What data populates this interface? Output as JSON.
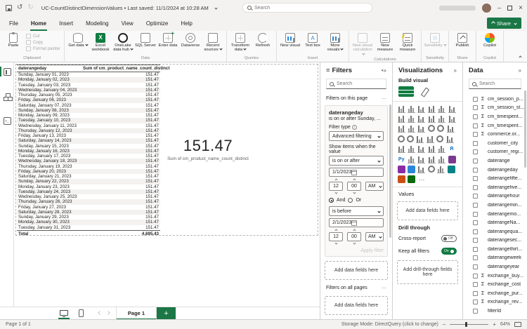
{
  "window": {
    "title": "UC-CountDistinctDimensionValues",
    "saved_info": "• Last saved: 11/1/2024 at 10:28 AM",
    "search_placeholder": "Search"
  },
  "menu": {
    "items": [
      "File",
      "Home",
      "Insert",
      "Modeling",
      "View",
      "Optimize",
      "Help"
    ],
    "active": "Home",
    "share_label": "Share"
  },
  "ribbon": {
    "groups": [
      {
        "name": "Clipboard",
        "buttons": [
          {
            "label": "Paste",
            "icon": "paste",
            "size": "large"
          },
          {
            "label": "Cut",
            "icon": "cut",
            "size": "small",
            "disabled": true
          },
          {
            "label": "Copy",
            "icon": "copy",
            "size": "small",
            "disabled": true
          },
          {
            "label": "Format painter",
            "icon": "format-painter",
            "size": "small",
            "disabled": true
          }
        ]
      },
      {
        "name": "Data",
        "buttons": [
          {
            "label": "Get data",
            "icon": "get-data",
            "dropdown": true
          },
          {
            "label": "Excel workbook",
            "icon": "excel"
          },
          {
            "label": "OneLake data hub",
            "icon": "onelake",
            "dropdown": true
          },
          {
            "label": "SQL Server",
            "icon": "sql-server"
          },
          {
            "label": "Enter data",
            "icon": "enter-data"
          },
          {
            "label": "Dataverse",
            "icon": "dataverse"
          },
          {
            "label": "Recent sources",
            "icon": "recent-sources",
            "dropdown": true
          }
        ]
      },
      {
        "name": "Queries",
        "buttons": [
          {
            "label": "Transform data",
            "icon": "transform-data",
            "dropdown": true
          },
          {
            "label": "Refresh",
            "icon": "refresh"
          }
        ]
      },
      {
        "name": "Insert",
        "buttons": [
          {
            "label": "New visual",
            "icon": "new-visual"
          },
          {
            "label": "Text box",
            "icon": "text-box"
          },
          {
            "label": "More visuals",
            "icon": "more-visuals",
            "dropdown": true
          }
        ]
      },
      {
        "name": "Calculations",
        "buttons": [
          {
            "label": "New visual calculation",
            "icon": "new-visual-calculation",
            "dropdown": true,
            "disabled": true
          },
          {
            "label": "New measure",
            "icon": "new-measure"
          },
          {
            "label": "Quick measure",
            "icon": "quick-measure"
          }
        ]
      },
      {
        "name": "Sensitivity",
        "buttons": [
          {
            "label": "Sensitivity",
            "icon": "sensitivity",
            "dropdown": true,
            "disabled": true
          }
        ]
      },
      {
        "name": "Share",
        "buttons": [
          {
            "label": "Publish",
            "icon": "publish"
          }
        ]
      },
      {
        "name": "Copilot",
        "buttons": [
          {
            "label": "Copilot",
            "icon": "copilot"
          }
        ]
      }
    ]
  },
  "table": {
    "col1": "daterangeday",
    "col2": "Sum of cm_product_name_count_distinct",
    "rows": [
      [
        "Sunday, January 01, 2023",
        "151.47"
      ],
      [
        "Monday, January 02, 2023",
        "151.47"
      ],
      [
        "Tuesday, January 03, 2023",
        "151.47"
      ],
      [
        "Wednesday, January 04, 2023",
        "151.47"
      ],
      [
        "Thursday, January 05, 2023",
        "151.47"
      ],
      [
        "Friday, January 06, 2023",
        "151.47"
      ],
      [
        "Saturday, January 07, 2023",
        "151.47"
      ],
      [
        "Sunday, January 08, 2023",
        "151.47"
      ],
      [
        "Monday, January 09, 2023",
        "151.47"
      ],
      [
        "Tuesday, January 10, 2023",
        "151.47"
      ],
      [
        "Wednesday, January 11, 2023",
        "151.47"
      ],
      [
        "Thursday, January 12, 2023",
        "151.47"
      ],
      [
        "Friday, January 13, 2023",
        "151.47"
      ],
      [
        "Saturday, January 14, 2023",
        "151.47"
      ],
      [
        "Sunday, January 15, 2023",
        "151.47"
      ],
      [
        "Monday, January 16, 2023",
        "151.47"
      ],
      [
        "Tuesday, January 17, 2023",
        "151.47"
      ],
      [
        "Wednesday, January 18, 2023",
        "151.47"
      ],
      [
        "Thursday, January 19, 2023",
        "151.47"
      ],
      [
        "Friday, January 20, 2023",
        "151.47"
      ],
      [
        "Saturday, January 21, 2023",
        "151.47"
      ],
      [
        "Sunday, January 22, 2023",
        "151.47"
      ],
      [
        "Monday, January 23, 2023",
        "151.47"
      ],
      [
        "Tuesday, January 24, 2023",
        "151.47"
      ],
      [
        "Wednesday, January 25, 2023",
        "151.47"
      ],
      [
        "Thursday, January 26, 2023",
        "151.47"
      ],
      [
        "Friday, January 27, 2023",
        "151.47"
      ],
      [
        "Saturday, January 28, 2023",
        "151.47"
      ],
      [
        "Sunday, January 29, 2023",
        "151.47"
      ],
      [
        "Monday, January 30, 2023",
        "151.47"
      ],
      [
        "Tuesday, January 31, 2023",
        "151.47"
      ]
    ],
    "total_label": "Total",
    "total_value": "4,695.43"
  },
  "card": {
    "value": "151.47",
    "label": "Sum of cm_product_name_count_distinct"
  },
  "filters": {
    "header": "Filters",
    "search_placeholder": "Search",
    "section_page": "Filters on this page",
    "card": {
      "field": "daterangeday",
      "summary": "is on or after Sunday, ...",
      "filter_type_label": "Filter type",
      "filter_type_value": "Advanced filtering",
      "show_items_label": "Show items when the value",
      "cond1": {
        "op": "is on or after",
        "date": "1/1/2023",
        "hour": "12",
        "minute": "00",
        "ampm": "AM"
      },
      "and_label": "And",
      "or_label": "Or",
      "cond2": {
        "op": "is before",
        "date": "2/1/2023",
        "hour": "12",
        "minute": "00",
        "ampm": "AM"
      },
      "apply_label": "Apply filter"
    },
    "add_fields": "Add data fields here",
    "section_all": "Filters on all pages",
    "add_fields2": "Add data fields here"
  },
  "viz": {
    "header": "Visualizations",
    "build_label": "Build visual",
    "values_label": "Values",
    "add_fields": "Add data fields here",
    "drill": {
      "title": "Drill through",
      "cross_report": "Cross-report",
      "cross_state": "Off",
      "keep_filters": "Keep all filters",
      "keep_state": "On",
      "add_fields": "Add drill-through fields here"
    },
    "icons": [
      "stacked-bar-chart",
      "stacked-column-chart",
      "clustered-bar-chart",
      "clustered-column-chart",
      "100-stacked-bar-chart",
      "100-stacked-column-chart",
      "line-chart",
      "area-chart",
      "stacked-area-chart",
      "line-stacked-column-chart",
      "line-clustered-column-chart",
      "ribbon-chart",
      "waterfall-chart",
      "funnel-chart",
      "scatter-chart",
      "pie-chart",
      "donut-chart",
      "treemap",
      "map",
      "filled-map",
      "shape-map",
      "azure-map",
      "gauge",
      "card",
      "multi-row-card",
      "kpi",
      "slicer",
      "table",
      "matrix",
      "r-script-visual",
      "python-visual",
      "key-influencers",
      "decomposition-tree",
      "qa-visual",
      "paginated-report",
      "metrics",
      "power-apps",
      "power-automate",
      "smart-narrative",
      "arcgis-map",
      "goal-metrics",
      "custom-visual",
      "custom-visual-2",
      "custom-visual-3",
      "more-options"
    ]
  },
  "data_pane": {
    "header": "Data",
    "search_placeholder": "Search",
    "fields": [
      {
        "name": "cm_session_p...",
        "measure": true
      },
      {
        "name": "cm_session_st...",
        "measure": true
      },
      {
        "name": "cm_timespent...",
        "measure": true
      },
      {
        "name": "cm_timespent...",
        "measure": true
      },
      {
        "name": "commerce.or...",
        "measure": true
      },
      {
        "name": "customer_city",
        "measure": false
      },
      {
        "name": "customer_regi...",
        "measure": false
      },
      {
        "name": "daterange",
        "measure": false
      },
      {
        "name": "daterangeday",
        "measure": false
      },
      {
        "name": "daterangefifte...",
        "measure": false
      },
      {
        "name": "daterangefive...",
        "measure": false
      },
      {
        "name": "daterangehour",
        "measure": false
      },
      {
        "name": "daterangemin...",
        "measure": false
      },
      {
        "name": "daterangemo...",
        "measure": false
      },
      {
        "name": "daterangeNa...",
        "measure": false
      },
      {
        "name": "daterangequa...",
        "measure": false
      },
      {
        "name": "daterangesec...",
        "measure": false
      },
      {
        "name": "daterangethirt...",
        "measure": false
      },
      {
        "name": "daterangeweek",
        "measure": false
      },
      {
        "name": "daterangeyear",
        "measure": false
      },
      {
        "name": "exchange_buy...",
        "measure": true
      },
      {
        "name": "exchange_cost",
        "measure": true
      },
      {
        "name": "exchange_pur...",
        "measure": true
      },
      {
        "name": "exchange_rev...",
        "measure": true
      },
      {
        "name": "filterId",
        "measure": false
      }
    ]
  },
  "pagebar": {
    "page_tab": "Page 1"
  },
  "statusbar": {
    "page_status": "Page 1 of 1",
    "storage_mode": "Storage Mode: DirectQuery (click to change)",
    "zoom": "64%"
  }
}
